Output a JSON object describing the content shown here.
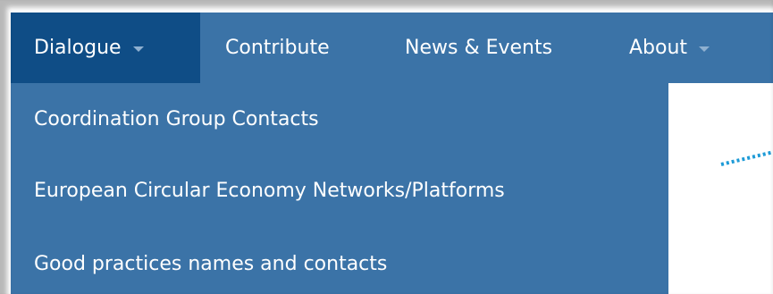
{
  "nav": {
    "items": [
      {
        "label": "Dialogue",
        "has_caret": true,
        "active": true
      },
      {
        "label": "Contribute",
        "has_caret": false,
        "active": false
      },
      {
        "label": "News & Events",
        "has_caret": false,
        "active": false
      },
      {
        "label": "About",
        "has_caret": true,
        "active": false
      }
    ]
  },
  "dropdown": {
    "items": [
      {
        "label": "Coordination Group Contacts"
      },
      {
        "label": "European Circular Economy Networks/Platforms"
      },
      {
        "label": "Good practices names and contacts"
      }
    ]
  },
  "colors": {
    "nav_bg": "#3b73a7",
    "nav_active_bg": "#0f4d86",
    "text": "#ffffff",
    "caret": "#8fb0d0",
    "dotted_line": "#1e9bd7"
  }
}
